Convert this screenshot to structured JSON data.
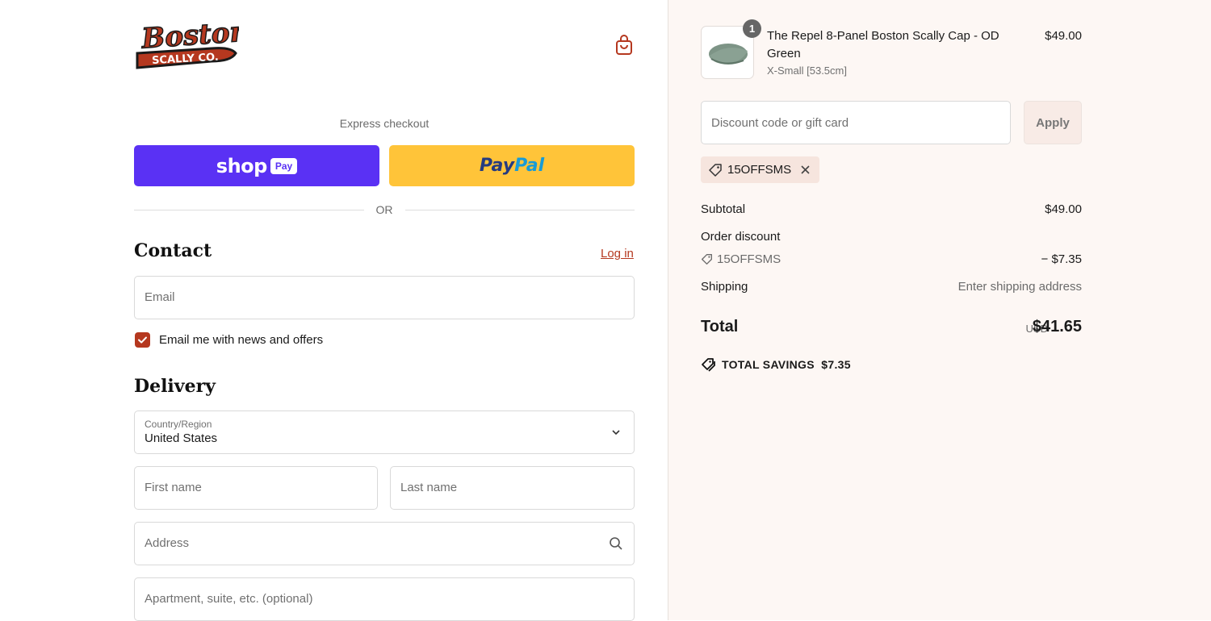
{
  "brand": {
    "logo_line1": "Boston",
    "logo_line2": "SCALLY CO."
  },
  "express": {
    "label": "Express checkout",
    "shop_word": "shop",
    "shop_pay": "Pay",
    "paypal_1": "Pay",
    "paypal_2": "Pal"
  },
  "or_text": "OR",
  "contact": {
    "heading": "Contact",
    "login": "Log in",
    "email_placeholder": "Email",
    "newsletter_label": "Email me with news and offers",
    "newsletter_checked": true
  },
  "delivery": {
    "heading": "Delivery",
    "country_label": "Country/Region",
    "country_value": "United States",
    "first_name_placeholder": "First name",
    "last_name_placeholder": "Last name",
    "address_placeholder": "Address",
    "apartment_placeholder": "Apartment, suite, etc. (optional)"
  },
  "colors": {
    "accent": "#b5381f",
    "shop_pay": "#5a31f4",
    "paypal": "#ffc439",
    "summary_bg": "#fdf7f4"
  },
  "summary": {
    "item": {
      "quantity": "1",
      "name": "The Repel 8-Panel Boston Scally Cap - OD Green",
      "variant": "X-Small [53.5cm]",
      "price": "$49.00"
    },
    "discount_placeholder": "Discount code or gift card",
    "apply_label": "Apply",
    "applied_code": "15OFFSMS",
    "subtotal_label": "Subtotal",
    "subtotal_value": "$49.00",
    "order_discount_label": "Order discount",
    "discount_code": "15OFFSMS",
    "discount_value": "− $7.35",
    "shipping_label": "Shipping",
    "shipping_value": "Enter shipping address",
    "total_label": "Total",
    "total_currency": "USD",
    "total_value": "$41.65",
    "savings_label": "TOTAL SAVINGS",
    "savings_value": "$7.35"
  }
}
